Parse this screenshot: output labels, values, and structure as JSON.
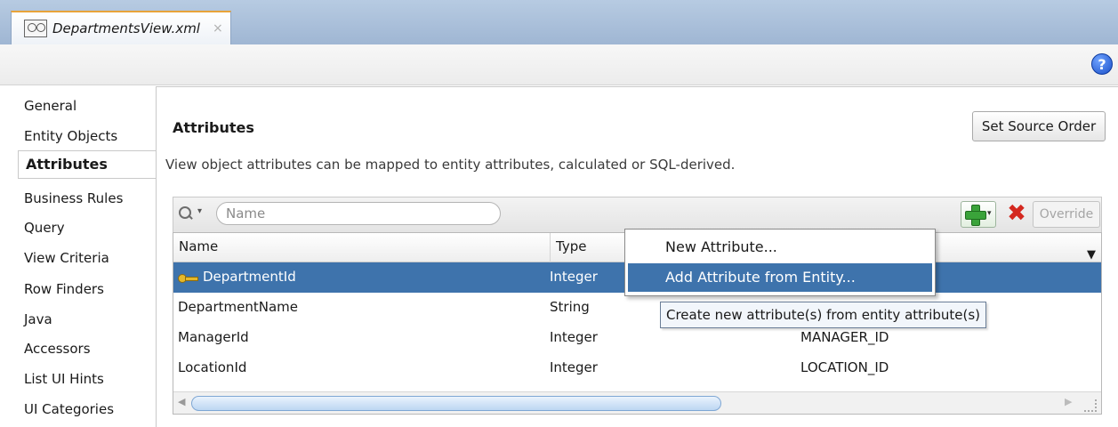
{
  "editor_tab": {
    "title": "DepartmentsView.xml",
    "close_glyph": "×"
  },
  "help": {
    "glyph": "?"
  },
  "nav": {
    "items": [
      {
        "label": "General"
      },
      {
        "label": "Entity Objects"
      },
      {
        "label": "Attributes"
      },
      {
        "label": "Business Rules"
      },
      {
        "label": "Query"
      },
      {
        "label": "View Criteria"
      },
      {
        "label": "Row Finders"
      },
      {
        "label": "Java"
      },
      {
        "label": "Accessors"
      },
      {
        "label": "List UI Hints"
      },
      {
        "label": "UI Categories"
      }
    ],
    "selected": "Attributes"
  },
  "attributes": {
    "title": "Attributes",
    "set_source_order_label": "Set Source Order",
    "description": "View object attributes can be mapped to entity attributes, calculated or SQL-derived.",
    "search": {
      "placeholder": "Name",
      "value": ""
    },
    "override_label": "Override",
    "columns": [
      "Name",
      "Type"
    ],
    "rows": [
      {
        "name": "DepartmentId",
        "type": "Integer",
        "column": "",
        "primary_key": true,
        "selected": true
      },
      {
        "name": "DepartmentName",
        "type": "String",
        "column": ""
      },
      {
        "name": "ManagerId",
        "type": "Integer",
        "column": "MANAGER_ID"
      },
      {
        "name": "LocationId",
        "type": "Integer",
        "column": "LOCATION_ID"
      }
    ]
  },
  "context_menu": {
    "items": [
      {
        "label": "New Attribute..."
      },
      {
        "label": "Add Attribute from Entity...",
        "highlighted": true
      }
    ]
  },
  "tooltip": {
    "text": "Create new attribute(s) from entity attribute(s)"
  },
  "glyphs": {
    "dropdown": "▾",
    "column_menu": "▼",
    "delete": "✖",
    "scroll_left": "◀",
    "scroll_right": "▶"
  },
  "icons": {
    "tab": "view-object-icon",
    "help": "help-icon",
    "search": "search-icon",
    "add": "green-plus-icon",
    "delete": "red-x-icon",
    "primary_key": "key-icon"
  },
  "colors": {
    "selection": "#3e73ac",
    "tab_bar": "#9fb6d3",
    "add_green": "#3aa33a",
    "delete_red": "#d4281f"
  }
}
